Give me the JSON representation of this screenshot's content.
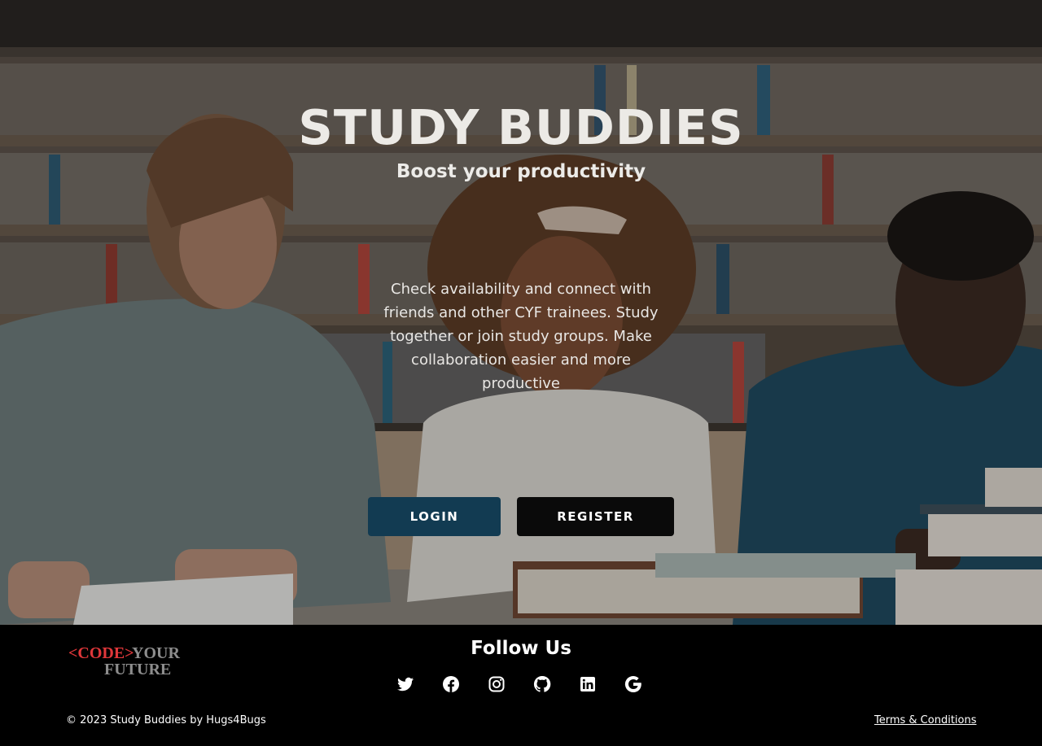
{
  "hero": {
    "title": "STUDY BUDDIES",
    "subtitle": "Boost your productivity",
    "description": "Check availability and connect with friends and other CYF trainees. Study together or join study groups. Make collaboration easier and more productive",
    "login_label": "LOGIN",
    "register_label": "REGISTER",
    "colors": {
      "login_button": "#123b52",
      "register_button": "#0a0a0a",
      "title_text": "#eceae6"
    }
  },
  "footer": {
    "logo": {
      "part1": "<CODE>",
      "part2": "YOUR",
      "part3": "FUTURE",
      "colors": {
        "accent": "#e0373a",
        "muted": "#8d8d8d"
      }
    },
    "follow_title": "Follow Us",
    "social_icons": [
      "twitter-icon",
      "facebook-icon",
      "instagram-icon",
      "github-icon",
      "linkedin-icon",
      "google-icon"
    ],
    "copyright": "© 2023 Study Buddies by Hugs4Bugs",
    "terms_label": "Terms & Conditions"
  }
}
